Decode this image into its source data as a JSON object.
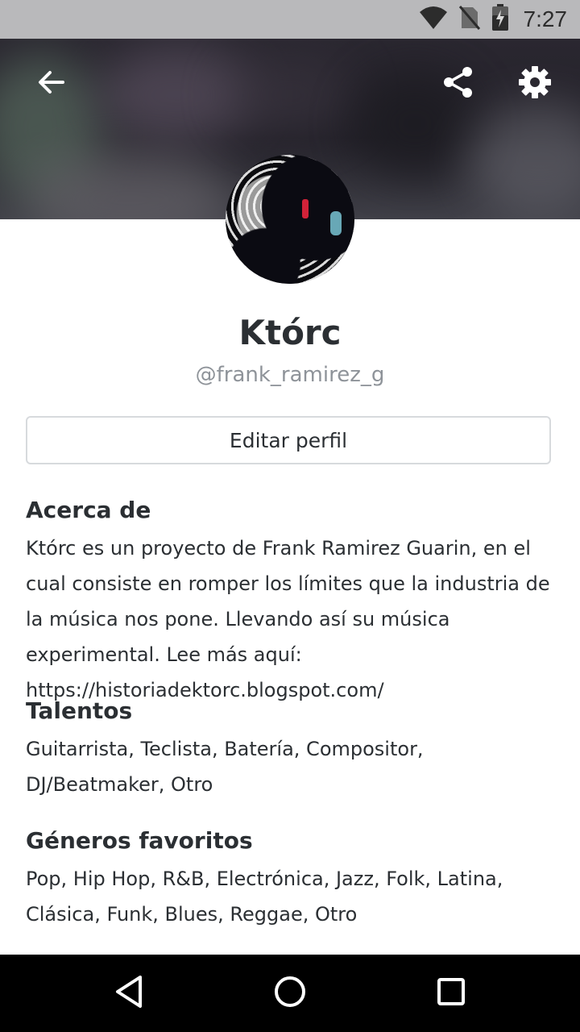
{
  "status_bar": {
    "time": "7:27",
    "icons": [
      "wifi-icon",
      "no-sim-icon",
      "battery-charging-icon"
    ]
  },
  "header": {
    "icons": [
      "back-arrow-icon",
      "share-icon",
      "gear-icon"
    ]
  },
  "profile": {
    "name": "Którc",
    "handle": "@frank_ramirez_g",
    "edit_button_label": "Editar perfil"
  },
  "sections": {
    "about": {
      "title": "Acerca de",
      "text": "Którc es un proyecto de Frank Ramirez Guarin, en el cual consiste en romper los límites que la industria de la música nos pone. Llevando así su música experimental. Lee más aquí:  https://historiadektorc.blogspot.com/"
    },
    "talents": {
      "title": "Talentos",
      "text": "Guitarrista, Teclista, Batería, Compositor, DJ/Beatmaker, Otro"
    },
    "genres": {
      "title": "Géneros favoritos",
      "text": "Pop, Hip Hop, R&B, Electrónica, Jazz, Folk, Latina, Clásica, Funk, Blues, Reggae, Otro"
    }
  },
  "nav_bar": {
    "icons": [
      "back-triangle-icon",
      "home-circle-icon",
      "recents-square-icon"
    ]
  }
}
